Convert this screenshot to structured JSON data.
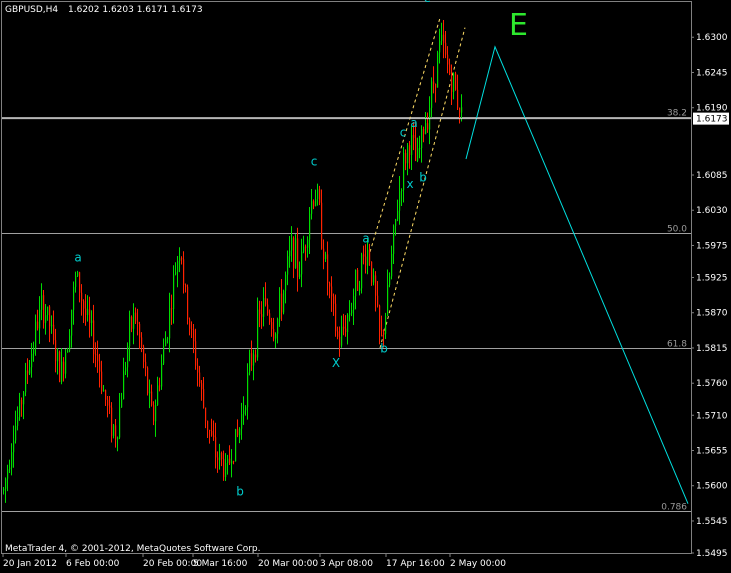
{
  "header": {
    "symbol": "GBPUSD,H4",
    "ohlc": "1.6202 1.6203 1.6171 1.6173"
  },
  "footer": {
    "copyright": "MetaTrader 4, © 2001-2012, MetaQuotes Software Corp."
  },
  "colors": {
    "background": "#000000",
    "bull": "#00dd00",
    "bear": "#ff2200",
    "wave": "#00cccc",
    "projection": "#00e0e0",
    "channel": "#ffdd66",
    "fibo": "#a0a0a0",
    "e_label": "#2ee82e"
  },
  "chart_data": {
    "type": "candlestick",
    "symbol": "GBPUSD",
    "timeframe": "H4",
    "ylim": [
      1.5495,
      1.6355
    ],
    "y_ticks": [
      "1.6300",
      "1.6245",
      "1.6190",
      "1.6085",
      "1.6030",
      "1.5975",
      "1.5925",
      "1.5870",
      "1.5815",
      "1.5760",
      "1.5710",
      "1.5655",
      "1.5600",
      "1.5545",
      "1.5495"
    ],
    "x_ticks": [
      "20 Jan 2012",
      "6 Feb 00:00",
      "20 Feb 00:00",
      "5 Mar 16:00",
      "20 Mar 00:00",
      "3 Apr 08:00",
      "17 Apr 16:00",
      "2 May 00:00"
    ],
    "current_price": "1.6173",
    "fibo_levels": [
      {
        "label": "38.2",
        "price": 1.6175
      },
      {
        "label": "50.0",
        "price": 1.5995
      },
      {
        "label": "61.8",
        "price": 1.5815
      },
      {
        "label": "0.786",
        "price": 1.556
      }
    ],
    "price_path": [
      [
        0,
        1.5565
      ],
      [
        6,
        1.562
      ],
      [
        12,
        1.568
      ],
      [
        18,
        1.571
      ],
      [
        24,
        1.576
      ],
      [
        30,
        1.58
      ],
      [
        36,
        1.585
      ],
      [
        42,
        1.588
      ],
      [
        48,
        1.586
      ],
      [
        54,
        1.581
      ],
      [
        60,
        1.577
      ],
      [
        66,
        1.582
      ],
      [
        72,
        1.589
      ],
      [
        76,
        1.593
      ],
      [
        80,
        1.59
      ],
      [
        86,
        1.586
      ],
      [
        92,
        1.583
      ],
      [
        98,
        1.579
      ],
      [
        104,
        1.574
      ],
      [
        110,
        1.57
      ],
      [
        116,
        1.568
      ],
      [
        122,
        1.576
      ],
      [
        128,
        1.583
      ],
      [
        134,
        1.587
      ],
      [
        140,
        1.582
      ],
      [
        146,
        1.576
      ],
      [
        152,
        1.57
      ],
      [
        158,
        1.576
      ],
      [
        164,
        1.582
      ],
      [
        170,
        1.588
      ],
      [
        176,
        1.595
      ],
      [
        180,
        1.598
      ],
      [
        184,
        1.59
      ],
      [
        190,
        1.584
      ],
      [
        196,
        1.579
      ],
      [
        202,
        1.573
      ],
      [
        208,
        1.569
      ],
      [
        214,
        1.565
      ],
      [
        220,
        1.564
      ],
      [
        226,
        1.562
      ],
      [
        232,
        1.566
      ],
      [
        238,
        1.568
      ],
      [
        244,
        1.574
      ],
      [
        250,
        1.579
      ],
      [
        256,
        1.584
      ],
      [
        262,
        1.588
      ],
      [
        268,
        1.587
      ],
      [
        274,
        1.584
      ],
      [
        280,
        1.588
      ],
      [
        286,
        1.593
      ],
      [
        292,
        1.598
      ],
      [
        298,
        1.593
      ],
      [
        304,
        1.598
      ],
      [
        310,
        1.604
      ],
      [
        316,
        1.606
      ],
      [
        320,
        1.601
      ],
      [
        326,
        1.593
      ],
      [
        332,
        1.587
      ],
      [
        338,
        1.582
      ],
      [
        344,
        1.585
      ],
      [
        350,
        1.588
      ],
      [
        356,
        1.592
      ],
      [
        362,
        1.595
      ],
      [
        368,
        1.597
      ],
      [
        374,
        1.59
      ],
      [
        380,
        1.582
      ],
      [
        386,
        1.588
      ],
      [
        392,
        1.597
      ],
      [
        398,
        1.605
      ],
      [
        404,
        1.611
      ],
      [
        410,
        1.614
      ],
      [
        416,
        1.61
      ],
      [
        422,
        1.615
      ],
      [
        428,
        1.619
      ],
      [
        434,
        1.624
      ],
      [
        440,
        1.6295
      ],
      [
        446,
        1.626
      ],
      [
        450,
        1.624
      ],
      [
        454,
        1.622
      ],
      [
        458,
        1.62
      ],
      [
        462,
        1.6173
      ]
    ],
    "annotations": [
      {
        "text": "a",
        "x": 78,
        "price": 1.595
      },
      {
        "text": "b",
        "x": 240,
        "price": 1.5585
      },
      {
        "text": "c",
        "x": 314,
        "price": 1.61
      },
      {
        "text": "X",
        "x": 336,
        "price": 1.5785
      },
      {
        "text": "a",
        "x": 366,
        "price": 1.598
      },
      {
        "text": "b",
        "x": 384,
        "price": 1.5808
      },
      {
        "text": "c",
        "x": 403,
        "price": 1.6145
      },
      {
        "text": "a",
        "x": 414,
        "price": 1.616
      },
      {
        "text": "x",
        "x": 410,
        "price": 1.6065
      },
      {
        "text": "b",
        "x": 423,
        "price": 1.6075
      },
      {
        "text": "c",
        "x": 427,
        "price": 1.6355
      }
    ],
    "e_label": "E",
    "projection": [
      [
        466,
        1.611
      ],
      [
        495,
        1.6285
      ],
      [
        688,
        1.5572
      ]
    ],
    "channel": {
      "lower": [
        [
          380,
          1.5815
        ],
        [
          465,
          1.6315
        ]
      ],
      "upper": [
        [
          370,
          1.5965
        ],
        [
          440,
          1.633
        ]
      ]
    }
  }
}
